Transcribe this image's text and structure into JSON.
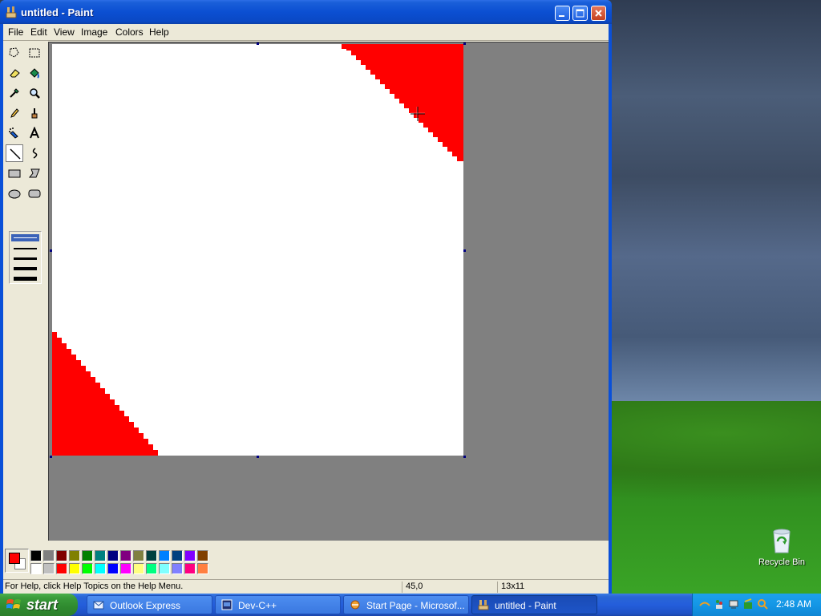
{
  "window": {
    "title": "untitled - Paint"
  },
  "menu": [
    "File",
    "Edit",
    "View",
    "Image",
    "Colors",
    "Help"
  ],
  "tools": [
    "free-form-select",
    "select",
    "eraser",
    "fill-with-color",
    "pick-color",
    "magnifier",
    "pencil",
    "brush",
    "airbrush",
    "text",
    "line",
    "curve",
    "rectangle",
    "polygon",
    "ellipse",
    "rounded-rectangle"
  ],
  "active_tool": "line",
  "colors": {
    "foreground": "#ff0000",
    "background": "#ffffff",
    "paint_red": "#ff0000"
  },
  "palette": {
    "row1": [
      "#000000",
      "#808080",
      "#800000",
      "#808000",
      "#008000",
      "#008080",
      "#000080",
      "#800080",
      "#808040",
      "#004040",
      "#0080ff",
      "#004080",
      "#8000ff",
      "#804000"
    ],
    "row2": [
      "#ffffff",
      "#c0c0c0",
      "#ff0000",
      "#ffff00",
      "#00ff00",
      "#00ffff",
      "#0000ff",
      "#ff00ff",
      "#ffff80",
      "#00ff80",
      "#80ffff",
      "#8080ff",
      "#ff0080",
      "#ff8040"
    ]
  },
  "status": {
    "help_text": "For Help, click Help Topics on the Help Menu.",
    "coords": "45,0",
    "size": "13x11"
  },
  "taskbar": {
    "start_label": "start",
    "tasks": [
      {
        "label": "Outlook Express",
        "icon": "outlook-express-icon"
      },
      {
        "label": "Dev-C++",
        "icon": "devcpp-icon"
      },
      {
        "label": "Start Page - Microsof...",
        "icon": "ie-icon"
      },
      {
        "label": "untitled - Paint",
        "icon": "paint-icon"
      }
    ],
    "clock": "2:48 AM"
  },
  "desktop": {
    "recycle_bin_label": "Recycle Bin"
  }
}
